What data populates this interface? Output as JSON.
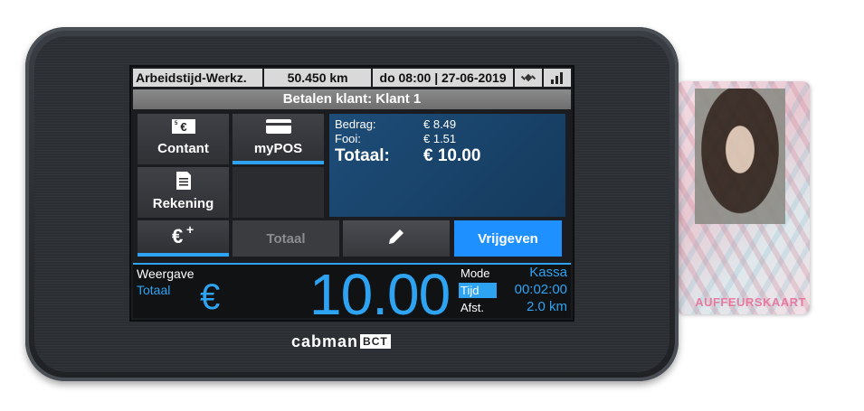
{
  "status_bar": {
    "activity": "Arbeidstijd-Werkz.",
    "odometer": "50.450 km",
    "datetime": "do 08:00 | 27-06-2019",
    "icons": [
      "satellite-icon",
      "signal-bars-icon"
    ]
  },
  "title": "Betalen klant: Klant 1",
  "payment_methods": {
    "contant": {
      "label": "Contant",
      "icon": "cash-euro-icon"
    },
    "mypos": {
      "label": "myPOS",
      "icon": "card-icon",
      "selected": true
    },
    "rekening": {
      "label": "Rekening",
      "icon": "invoice-icon"
    }
  },
  "summary": {
    "bedrag_label": "Bedrag:",
    "bedrag_value": "€ 8.49",
    "fooi_label": "Fooi:",
    "fooi_value": "€ 1.51",
    "totaal_label": "Totaal:",
    "totaal_value": "€ 10.00"
  },
  "actions": {
    "add_tip_icon": "euro-plus-icon",
    "totaal_label": "Totaal",
    "edit_icon": "pencil-icon",
    "vrijgeven_label": "Vrijgeven"
  },
  "meter": {
    "weergave_label": "Weergave",
    "weergave_value": "Totaal",
    "currency": "€",
    "amount": "10.00",
    "mode_label": "Mode",
    "mode_value": "Kassa",
    "tijd_label": "Tijd",
    "tijd_value": "00:02:00",
    "afst_label": "Afst.",
    "afst_value": "2.0 km"
  },
  "device": {
    "brand": "cabman",
    "brand_badge": "BCT"
  },
  "driver_card": {
    "label": "AUFFEURSKAART"
  },
  "colors": {
    "accent": "#2ea3f2",
    "info_panel": "#1d4d78",
    "vrijgeven_button": "#1e90ff"
  }
}
